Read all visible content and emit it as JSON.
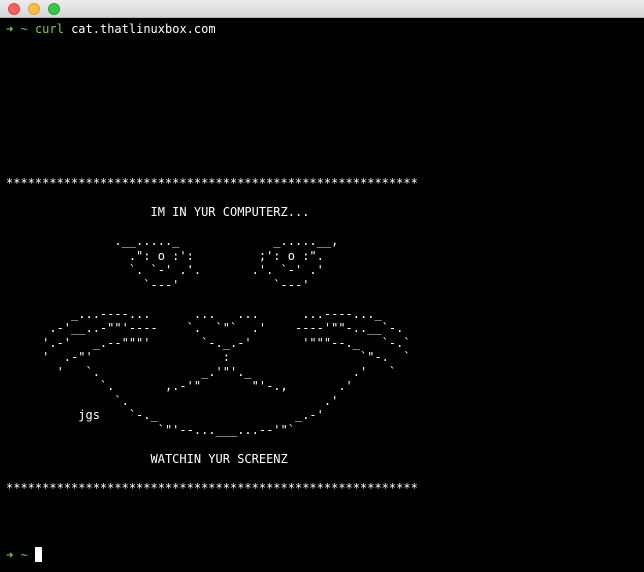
{
  "window": {
    "buttons": [
      "close",
      "minimize",
      "zoom"
    ]
  },
  "prompt": {
    "arrow": "➜",
    "tilde": "~",
    "command": "curl",
    "argument": "cat.thatlinuxbox.com"
  },
  "output": {
    "ascii_art": "*********************************************************\n\n                    IM IN YUR COMPUTERZ...\n\n               .__....._             _.....__,\n                 .\": o :':         ;': o :\".\n                 `. `-' .'.       .'. `-' .'\n                   `---'             `---'\n\n         _...----...      ...   ...      ...----..._\n      .-'__..-\"\"'----    `.  `\"`  .'    ----'\"\"-..__`-.\n     '.-'   _.--\"\"\"'       `-._.-'       '\"\"\"--._   `-.`\n     '  .-\"'                  :                  `\"-.  `\n       '   `.              _.'\"'._              .'   `\n             `.       ,.-'\"       \"'-.,       .'\n               `.                           .'\n          jgs    `-._                   _.-'\n                     `\"'--...___...--'\"`\n\n                    WATCHIN YUR SCREENZ\n\n*********************************************************"
  },
  "next_prompt": {
    "arrow": "➜",
    "tilde": "~"
  }
}
